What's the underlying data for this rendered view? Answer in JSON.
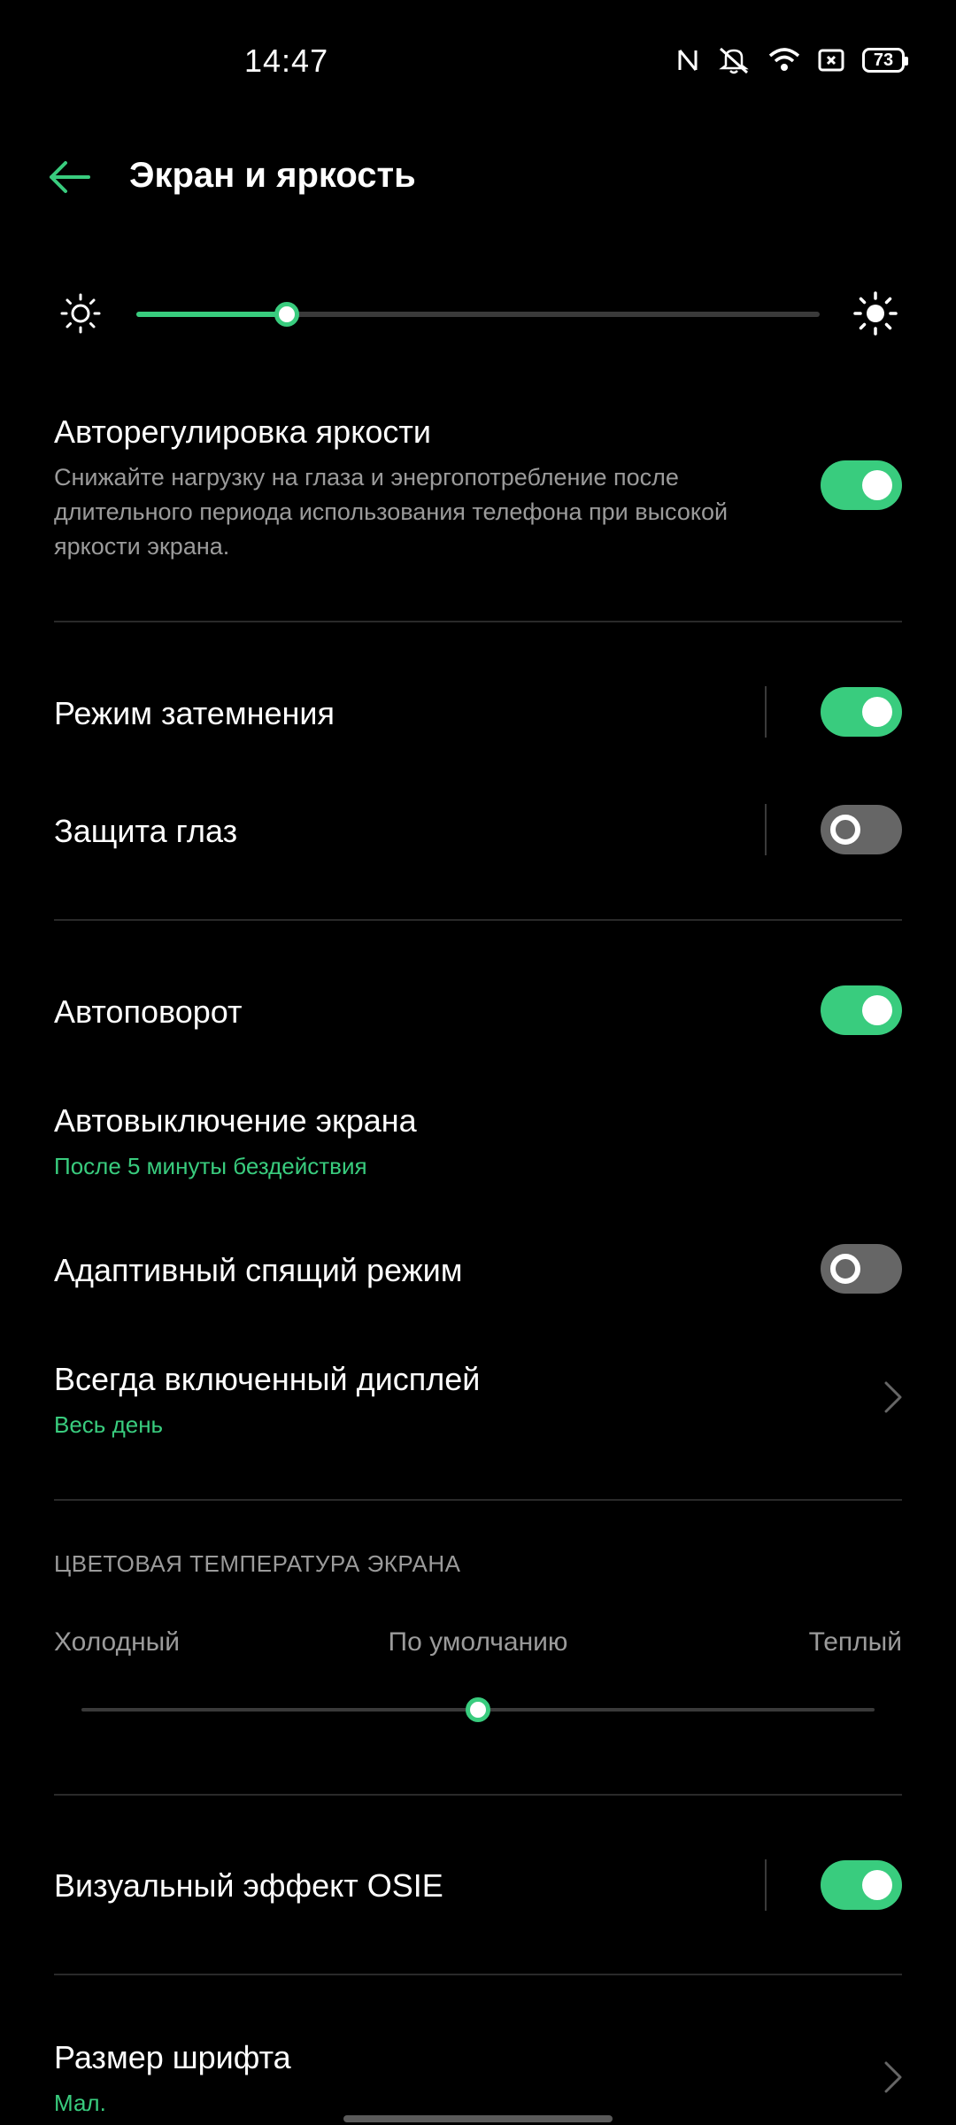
{
  "status": {
    "time": "14:47",
    "battery": "73"
  },
  "header": {
    "title": "Экран и яркость"
  },
  "brightness": {
    "level_percent": 22
  },
  "auto_brightness": {
    "title": "Авторегулировка яркости",
    "description": "Снижайте нагрузку на глаза и энергопотребление после длительного периода использования телефона при высокой яркости экрана.",
    "enabled": true
  },
  "dark_mode": {
    "title": "Режим затемнения",
    "enabled": true
  },
  "eye_protection": {
    "title": "Защита глаз",
    "enabled": false
  },
  "auto_rotate": {
    "title": "Автоповорот",
    "enabled": true
  },
  "screen_timeout": {
    "title": "Автовыключение экрана",
    "value": "После 5 минуты бездействия"
  },
  "adaptive_sleep": {
    "title": "Адаптивный спящий режим",
    "enabled": false
  },
  "always_on": {
    "title": "Всегда включенный дисплей",
    "value": "Весь день"
  },
  "color_temperature": {
    "header": "ЦВЕТОВАЯ ТЕМПЕРАТУРА ЭКРАНА",
    "cold_label": "Холодный",
    "default_label": "По умолчанию",
    "warm_label": "Теплый",
    "level_percent": 50
  },
  "osie": {
    "title": "Визуальный эффект OSIE",
    "enabled": true
  },
  "font_size": {
    "title": "Размер шрифта",
    "value": "Мал."
  },
  "colors": {
    "accent": "#39cc7e",
    "background": "#000000",
    "secondary_text": "#9b9b9b"
  }
}
